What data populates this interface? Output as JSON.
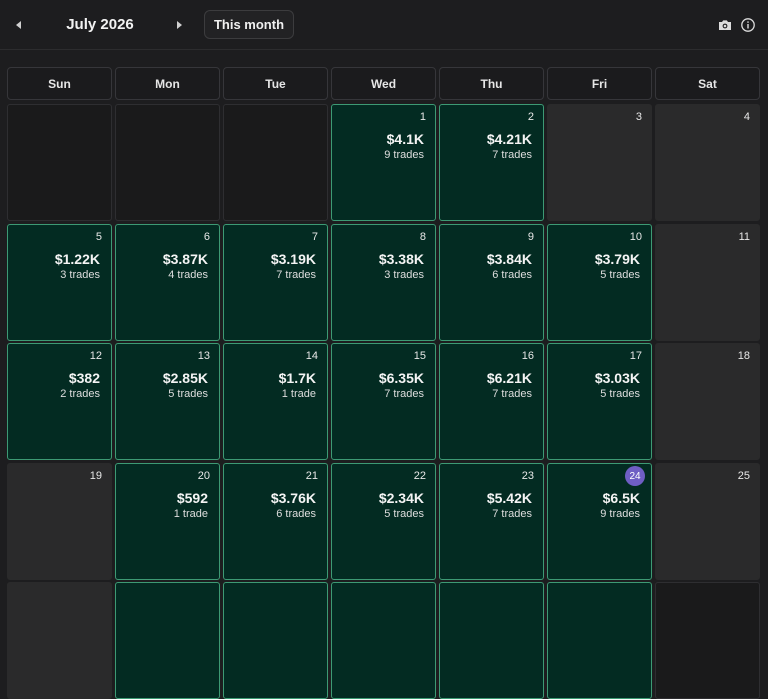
{
  "header": {
    "month_title": "July 2026",
    "this_month_label": "This month",
    "icons": [
      "chevron-left-icon",
      "chevron-right-icon",
      "camera-icon",
      "info-icon"
    ]
  },
  "weekdays": [
    "Sun",
    "Mon",
    "Tue",
    "Wed",
    "Thu",
    "Fri",
    "Sat"
  ],
  "colors": {
    "profit_cell": "#032b22",
    "profit_border": "#3d9a74",
    "today_badge": "#6f5ec4"
  },
  "today": "24",
  "weeks": [
    [
      {
        "kind": "empty"
      },
      {
        "kind": "empty"
      },
      {
        "kind": "empty"
      },
      {
        "kind": "trade",
        "day": "1",
        "pnl": "$4.1K",
        "trades": "9 trades"
      },
      {
        "kind": "trade",
        "day": "2",
        "pnl": "$4.21K",
        "trades": "7 trades"
      },
      {
        "kind": "blank",
        "day": "3"
      },
      {
        "kind": "blank",
        "day": "4"
      }
    ],
    [
      {
        "kind": "trade",
        "day": "5",
        "pnl": "$1.22K",
        "trades": "3 trades"
      },
      {
        "kind": "trade",
        "day": "6",
        "pnl": "$3.87K",
        "trades": "4 trades"
      },
      {
        "kind": "trade",
        "day": "7",
        "pnl": "$3.19K",
        "trades": "7 trades"
      },
      {
        "kind": "trade",
        "day": "8",
        "pnl": "$3.38K",
        "trades": "3 trades"
      },
      {
        "kind": "trade",
        "day": "9",
        "pnl": "$3.84K",
        "trades": "6 trades"
      },
      {
        "kind": "trade",
        "day": "10",
        "pnl": "$3.79K",
        "trades": "5 trades"
      },
      {
        "kind": "blank",
        "day": "11"
      }
    ],
    [
      {
        "kind": "trade",
        "day": "12",
        "pnl": "$382",
        "trades": "2 trades"
      },
      {
        "kind": "trade",
        "day": "13",
        "pnl": "$2.85K",
        "trades": "5 trades"
      },
      {
        "kind": "trade",
        "day": "14",
        "pnl": "$1.7K",
        "trades": "1 trade"
      },
      {
        "kind": "trade",
        "day": "15",
        "pnl": "$6.35K",
        "trades": "7 trades"
      },
      {
        "kind": "trade",
        "day": "16",
        "pnl": "$6.21K",
        "trades": "7 trades"
      },
      {
        "kind": "trade",
        "day": "17",
        "pnl": "$3.03K",
        "trades": "5 trades"
      },
      {
        "kind": "blank",
        "day": "18"
      }
    ],
    [
      {
        "kind": "blank",
        "day": "19"
      },
      {
        "kind": "trade",
        "day": "20",
        "pnl": "$592",
        "trades": "1 trade"
      },
      {
        "kind": "trade",
        "day": "21",
        "pnl": "$3.76K",
        "trades": "6 trades"
      },
      {
        "kind": "trade",
        "day": "22",
        "pnl": "$2.34K",
        "trades": "5 trades"
      },
      {
        "kind": "trade",
        "day": "23",
        "pnl": "$5.42K",
        "trades": "7 trades"
      },
      {
        "kind": "trade",
        "day": "24",
        "pnl": "$6.5K",
        "trades": "9 trades"
      },
      {
        "kind": "blank",
        "day": "25"
      }
    ],
    [
      {
        "kind": "blank"
      },
      {
        "kind": "trade"
      },
      {
        "kind": "trade"
      },
      {
        "kind": "trade"
      },
      {
        "kind": "trade"
      },
      {
        "kind": "trade"
      },
      {
        "kind": "empty"
      }
    ]
  ]
}
